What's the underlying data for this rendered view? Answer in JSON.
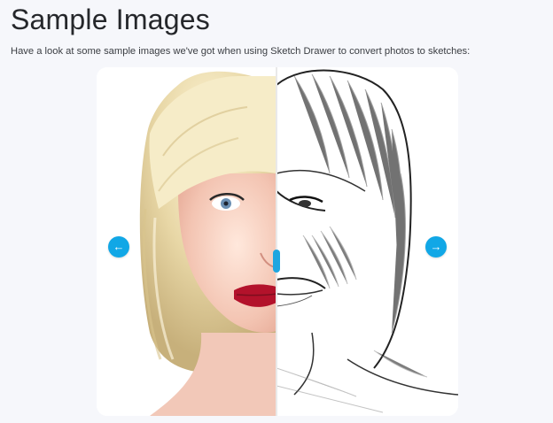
{
  "header": {
    "title": "Sample Images",
    "subtitle": "Have a look at some sample images we've got when using Sketch Drawer to convert photos to sketches:"
  },
  "slider": {
    "prev_icon": "←",
    "next_icon": "→",
    "accent_color": "#11a7e6"
  }
}
